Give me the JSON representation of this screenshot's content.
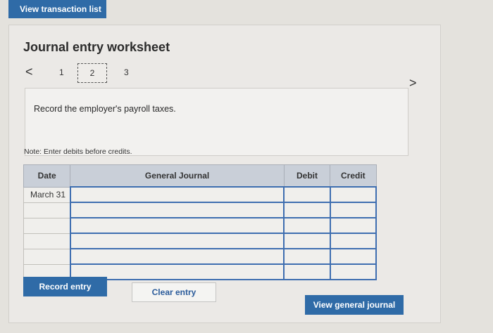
{
  "top_button": "View transaction list",
  "title": "Journal entry worksheet",
  "pager": {
    "prev": "<",
    "next": ">",
    "pages": [
      "1",
      "2",
      "3"
    ]
  },
  "instruction": "Record the employer's payroll taxes.",
  "note": "Note: Enter debits before credits.",
  "table": {
    "headers": {
      "date": "Date",
      "general_journal": "General Journal",
      "debit": "Debit",
      "credit": "Credit"
    },
    "rows": [
      {
        "date": "March 31",
        "account": "",
        "debit": "",
        "credit": ""
      },
      {
        "date": "",
        "account": "",
        "debit": "",
        "credit": ""
      },
      {
        "date": "",
        "account": "",
        "debit": "",
        "credit": ""
      },
      {
        "date": "",
        "account": "",
        "debit": "",
        "credit": ""
      },
      {
        "date": "",
        "account": "",
        "debit": "",
        "credit": ""
      },
      {
        "date": "",
        "account": "",
        "debit": "",
        "credit": ""
      }
    ]
  },
  "buttons": {
    "record": "Record entry",
    "clear": "Clear entry",
    "view_journal": "View general journal"
  }
}
